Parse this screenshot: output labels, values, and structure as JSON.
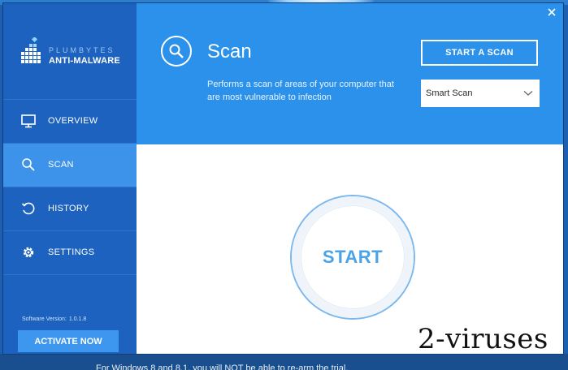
{
  "app": {
    "brand_top": "PLUMBYTES",
    "brand_bottom": "ANTI-MALWARE"
  },
  "sidebar": {
    "items": [
      {
        "label": "OVERVIEW",
        "icon": "monitor-icon",
        "active": false
      },
      {
        "label": "SCAN",
        "icon": "search-icon",
        "active": true
      },
      {
        "label": "HISTORY",
        "icon": "history-icon",
        "active": false
      },
      {
        "label": "SETTINGS",
        "icon": "gear-icon",
        "active": false
      }
    ],
    "version_label": "Software Version:",
    "version_value": "1.0.1.8",
    "activate_label": "ACTIVATE NOW"
  },
  "header": {
    "title": "Scan",
    "description": "Performs a scan of areas of your computer that are most vulnerable to infection",
    "start_scan_label": "START A SCAN",
    "scan_type_selected": "Smart Scan"
  },
  "main": {
    "start_label": "START"
  },
  "background": {
    "behind_text": "For Windows 8 and 8.1, you will NOT be able to re-arm the trial."
  },
  "watermark": "2-viruses",
  "colors": {
    "sidebar": "#1c62be",
    "sidebar_active": "#3d93ea",
    "header": "#2c91ea",
    "accent": "#4aa3e8"
  }
}
